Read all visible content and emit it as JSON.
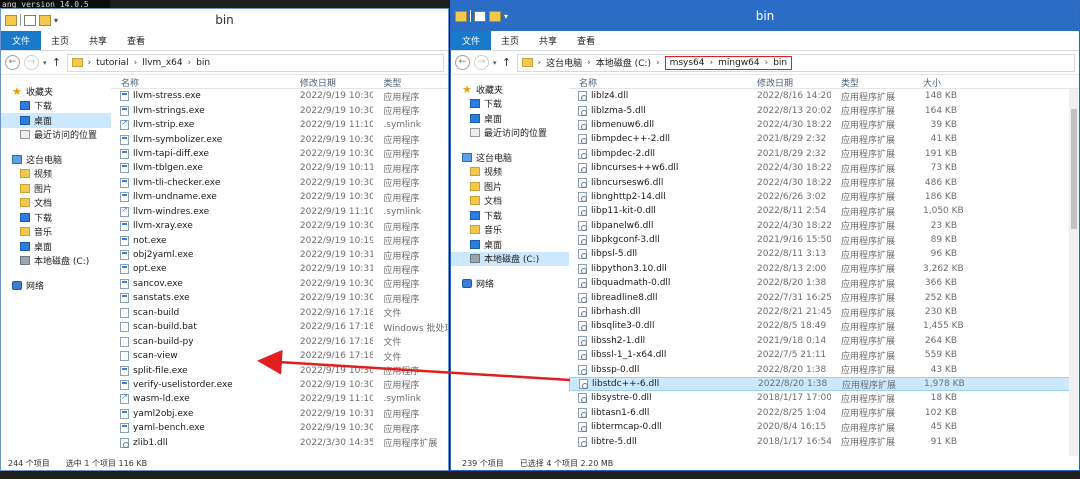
{
  "console": {
    "text": "ang version 14.0.5"
  },
  "left_window": {
    "title": "bin",
    "tabs": [
      "文件",
      "主页",
      "共享",
      "查看"
    ],
    "breadcrumb": [
      "tutorial",
      "llvm_x64",
      "bin"
    ],
    "nav": [
      {
        "label": "收藏夹",
        "icon": "star-icon"
      },
      {
        "label": "下载",
        "icon": "download-folder-icon"
      },
      {
        "label": "桌面",
        "icon": "desktop-icon"
      },
      {
        "label": "最近访问的位置",
        "icon": "recent-places-icon"
      },
      {
        "label": "这台电脑",
        "icon": "computer-icon"
      },
      {
        "label": "视频",
        "icon": "videos-folder-icon"
      },
      {
        "label": "图片",
        "icon": "pictures-folder-icon"
      },
      {
        "label": "文档",
        "icon": "documents-folder-icon"
      },
      {
        "label": "下载",
        "icon": "download-folder-icon"
      },
      {
        "label": "音乐",
        "icon": "music-folder-icon"
      },
      {
        "label": "桌面",
        "icon": "desktop-icon"
      },
      {
        "label": "本地磁盘 (C:)",
        "icon": "local-disk-icon"
      },
      {
        "label": "网络",
        "icon": "network-icon"
      }
    ],
    "columns": {
      "name": "名称",
      "date": "修改日期",
      "type": "类型"
    },
    "files": [
      {
        "name": "llvm-stress.exe",
        "date": "2022/9/19 10:30",
        "type": "应用程序",
        "kind": "exe"
      },
      {
        "name": "llvm-strings.exe",
        "date": "2022/9/19 10:30",
        "type": "应用程序",
        "kind": "exe"
      },
      {
        "name": "llvm-strip.exe",
        "date": "2022/9/19 11:10",
        "type": ".symlink",
        "kind": "link"
      },
      {
        "name": "llvm-symbolizer.exe",
        "date": "2022/9/19 10:30",
        "type": "应用程序",
        "kind": "exe"
      },
      {
        "name": "llvm-tapi-diff.exe",
        "date": "2022/9/19 10:30",
        "type": "应用程序",
        "kind": "exe"
      },
      {
        "name": "llvm-tblgen.exe",
        "date": "2022/9/19 10:11",
        "type": "应用程序",
        "kind": "exe"
      },
      {
        "name": "llvm-tli-checker.exe",
        "date": "2022/9/19 10:30",
        "type": "应用程序",
        "kind": "exe"
      },
      {
        "name": "llvm-undname.exe",
        "date": "2022/9/19 10:30",
        "type": "应用程序",
        "kind": "exe"
      },
      {
        "name": "llvm-windres.exe",
        "date": "2022/9/19 11:10",
        "type": ".symlink",
        "kind": "link"
      },
      {
        "name": "llvm-xray.exe",
        "date": "2022/9/19 10:30",
        "type": "应用程序",
        "kind": "exe"
      },
      {
        "name": "not.exe",
        "date": "2022/9/19 10:19",
        "type": "应用程序",
        "kind": "exe"
      },
      {
        "name": "obj2yaml.exe",
        "date": "2022/9/19 10:31",
        "type": "应用程序",
        "kind": "exe"
      },
      {
        "name": "opt.exe",
        "date": "2022/9/19 10:31",
        "type": "应用程序",
        "kind": "exe"
      },
      {
        "name": "sancov.exe",
        "date": "2022/9/19 10:30",
        "type": "应用程序",
        "kind": "exe"
      },
      {
        "name": "sanstats.exe",
        "date": "2022/9/19 10:30",
        "type": "应用程序",
        "kind": "exe"
      },
      {
        "name": "scan-build",
        "date": "2022/9/16 17:18",
        "type": "文件",
        "kind": "file"
      },
      {
        "name": "scan-build.bat",
        "date": "2022/9/16 17:18",
        "type": "Windows 批处理",
        "kind": "file"
      },
      {
        "name": "scan-build-py",
        "date": "2022/9/16 17:18",
        "type": "文件",
        "kind": "file"
      },
      {
        "name": "scan-view",
        "date": "2022/9/16 17:18",
        "type": "文件",
        "kind": "file"
      },
      {
        "name": "split-file.exe",
        "date": "2022/9/19 10:30",
        "type": "应用程序",
        "kind": "exe"
      },
      {
        "name": "verify-uselistorder.exe",
        "date": "2022/9/19 10:30",
        "type": "应用程序",
        "kind": "exe"
      },
      {
        "name": "wasm-ld.exe",
        "date": "2022/9/19 11:10",
        "type": ".symlink",
        "kind": "link"
      },
      {
        "name": "yaml2obj.exe",
        "date": "2022/9/19 10:31",
        "type": "应用程序",
        "kind": "exe"
      },
      {
        "name": "yaml-bench.exe",
        "date": "2022/9/19 10:30",
        "type": "应用程序",
        "kind": "exe"
      },
      {
        "name": "zlib1.dll",
        "date": "2022/3/30 14:35",
        "type": "应用程序扩展",
        "kind": "dll"
      }
    ],
    "status": {
      "count": "244 个项目",
      "selected": "选中 1 个项目",
      "size": "116 KB"
    }
  },
  "right_window": {
    "title": "bin",
    "tabs": [
      "文件",
      "主页",
      "共享",
      "查看"
    ],
    "breadcrumb_prefix": [
      "这台电脑",
      "本地磁盘 (C:)"
    ],
    "breadcrumb_highlight": [
      "msys64",
      "mingw64",
      "bin"
    ],
    "nav": [
      {
        "label": "收藏夹",
        "icon": "star-icon"
      },
      {
        "label": "下载",
        "icon": "download-folder-icon"
      },
      {
        "label": "桌面",
        "icon": "desktop-icon"
      },
      {
        "label": "最近访问的位置",
        "icon": "recent-places-icon"
      },
      {
        "label": "这台电脑",
        "icon": "computer-icon"
      },
      {
        "label": "视频",
        "icon": "videos-folder-icon"
      },
      {
        "label": "图片",
        "icon": "pictures-folder-icon"
      },
      {
        "label": "文档",
        "icon": "documents-folder-icon"
      },
      {
        "label": "下载",
        "icon": "download-folder-icon"
      },
      {
        "label": "音乐",
        "icon": "music-folder-icon"
      },
      {
        "label": "桌面",
        "icon": "desktop-icon"
      },
      {
        "label": "本地磁盘 (C:)",
        "icon": "local-disk-icon"
      },
      {
        "label": "网络",
        "icon": "network-icon"
      }
    ],
    "columns": {
      "name": "名称",
      "date": "修改日期",
      "type": "类型",
      "size": "大小"
    },
    "files": [
      {
        "name": "liblz4.dll",
        "date": "2022/8/16 14:20",
        "type": "应用程序扩展",
        "size": "148 KB"
      },
      {
        "name": "liblzma-5.dll",
        "date": "2022/8/13 20:02",
        "type": "应用程序扩展",
        "size": "164 KB"
      },
      {
        "name": "libmenuw6.dll",
        "date": "2022/4/30 18:22",
        "type": "应用程序扩展",
        "size": "39 KB"
      },
      {
        "name": "libmpdec++-2.dll",
        "date": "2021/8/29 2:32",
        "type": "应用程序扩展",
        "size": "41 KB"
      },
      {
        "name": "libmpdec-2.dll",
        "date": "2021/8/29 2:32",
        "type": "应用程序扩展",
        "size": "191 KB"
      },
      {
        "name": "libncurses++w6.dll",
        "date": "2022/4/30 18:22",
        "type": "应用程序扩展",
        "size": "73 KB"
      },
      {
        "name": "libncursesw6.dll",
        "date": "2022/4/30 18:22",
        "type": "应用程序扩展",
        "size": "486 KB"
      },
      {
        "name": "libnghttp2-14.dll",
        "date": "2022/6/26 3:02",
        "type": "应用程序扩展",
        "size": "186 KB"
      },
      {
        "name": "libp11-kit-0.dll",
        "date": "2022/8/11 2:54",
        "type": "应用程序扩展",
        "size": "1,050 KB"
      },
      {
        "name": "libpanelw6.dll",
        "date": "2022/4/30 18:22",
        "type": "应用程序扩展",
        "size": "23 KB"
      },
      {
        "name": "libpkgconf-3.dll",
        "date": "2021/9/16 15:50",
        "type": "应用程序扩展",
        "size": "89 KB"
      },
      {
        "name": "libpsl-5.dll",
        "date": "2022/8/11 3:13",
        "type": "应用程序扩展",
        "size": "96 KB"
      },
      {
        "name": "libpython3.10.dll",
        "date": "2022/8/13 2:00",
        "type": "应用程序扩展",
        "size": "3,262 KB"
      },
      {
        "name": "libquadmath-0.dll",
        "date": "2022/8/20 1:38",
        "type": "应用程序扩展",
        "size": "366 KB"
      },
      {
        "name": "libreadline8.dll",
        "date": "2022/7/31 16:25",
        "type": "应用程序扩展",
        "size": "252 KB"
      },
      {
        "name": "librhash.dll",
        "date": "2022/8/21 21:45",
        "type": "应用程序扩展",
        "size": "230 KB"
      },
      {
        "name": "libsqlite3-0.dll",
        "date": "2022/8/5 18:49",
        "type": "应用程序扩展",
        "size": "1,455 KB"
      },
      {
        "name": "libssh2-1.dll",
        "date": "2021/9/18 0:14",
        "type": "应用程序扩展",
        "size": "264 KB"
      },
      {
        "name": "libssl-1_1-x64.dll",
        "date": "2022/7/5 21:11",
        "type": "应用程序扩展",
        "size": "559 KB"
      },
      {
        "name": "libssp-0.dll",
        "date": "2022/8/20 1:38",
        "type": "应用程序扩展",
        "size": "43 KB"
      },
      {
        "name": "libstdc++-6.dll",
        "date": "2022/8/20 1:38",
        "type": "应用程序扩展",
        "size": "1,978 KB",
        "selected": true
      },
      {
        "name": "libsystre-0.dll",
        "date": "2018/1/17 17:00",
        "type": "应用程序扩展",
        "size": "18 KB"
      },
      {
        "name": "libtasn1-6.dll",
        "date": "2022/8/25 1:04",
        "type": "应用程序扩展",
        "size": "102 KB"
      },
      {
        "name": "libtermcap-0.dll",
        "date": "2020/8/4 16:15",
        "type": "应用程序扩展",
        "size": "45 KB"
      },
      {
        "name": "libtre-5.dll",
        "date": "2018/1/17 16:54",
        "type": "应用程序扩展",
        "size": "91 KB"
      }
    ],
    "status": {
      "count": "239 个项目",
      "selected": "已选择 4 个项目",
      "size": "2.20 MB"
    }
  },
  "colors": {
    "accent": "#1979ca",
    "selection": "#cce8ff",
    "highlight_box": "#e02020",
    "arrow": "#e02020"
  }
}
